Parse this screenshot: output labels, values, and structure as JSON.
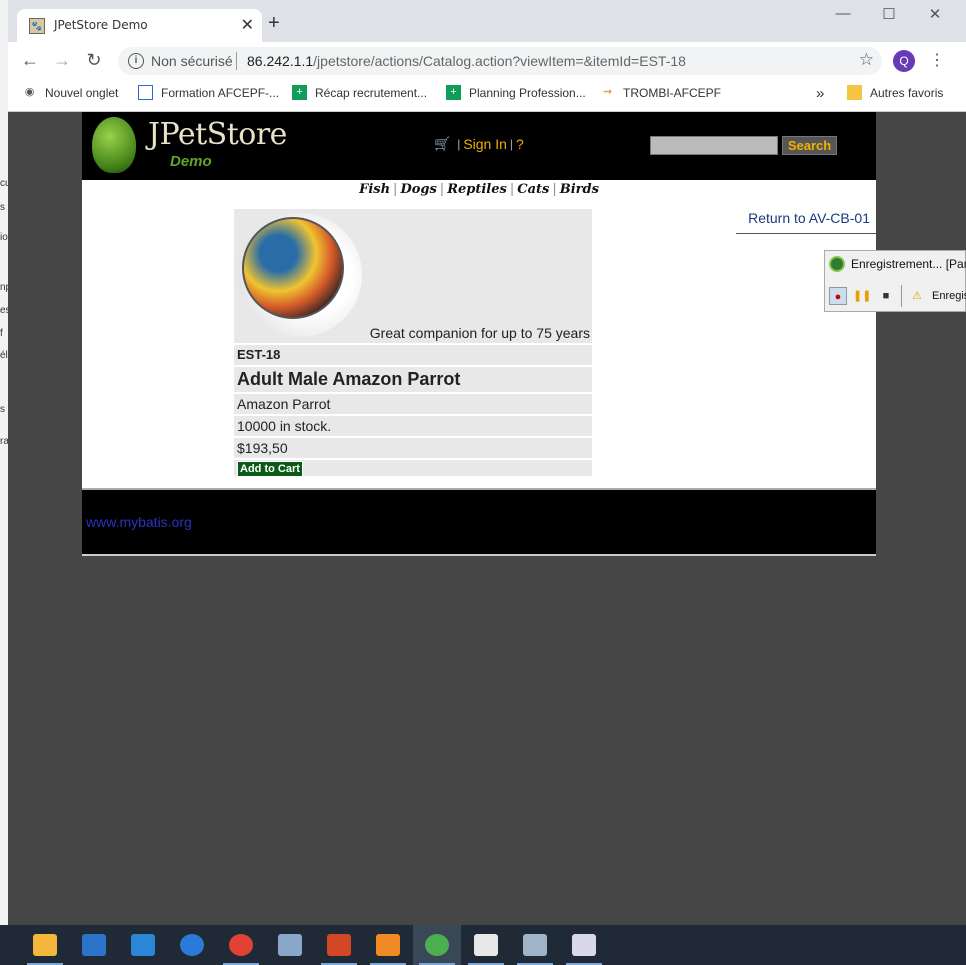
{
  "background_window_fragments": [
    "cu",
    "s",
    "io",
    "np",
    "es",
    "f",
    "él",
    "s l",
    "ra"
  ],
  "browser": {
    "tab_title": "JPetStore Demo",
    "tab_close": "✕",
    "new_tab": "+",
    "window_controls": {
      "minimize": "—",
      "maximize": "☐",
      "close": "✕"
    },
    "security_label": "Non sécurisé",
    "url_host": "86.242.1.1",
    "url_path": "/jpetstore/actions/Catalog.action?viewItem=&itemId=EST-18",
    "profile_initial": "Q",
    "bookmarks": [
      {
        "label": "Nouvel onglet",
        "icon": "globe-icon"
      },
      {
        "label": "Formation AFCEPF-...",
        "icon": "doc-icon"
      },
      {
        "label": "Récap recrutement...",
        "icon": "sheet-icon"
      },
      {
        "label": "Planning Profession...",
        "icon": "sheet-icon"
      },
      {
        "label": "TROMBI-AFCEPF",
        "icon": "link-icon"
      }
    ],
    "bookmarks_overflow": "»",
    "other_bookmarks": "Autres favoris"
  },
  "store": {
    "brand": "JPetStore",
    "brand_sub": "Demo",
    "sign_in": "Sign In",
    "help": "?",
    "search_button": "Search",
    "search_value": "",
    "categories": [
      "Fish",
      "Dogs",
      "Reptiles",
      "Cats",
      "Birds"
    ],
    "return_link": "Return to AV-CB-01",
    "item": {
      "description": "Great companion for up to 75 years",
      "id": "EST-18",
      "name": "Adult Male Amazon Parrot",
      "product": "Amazon Parrot",
      "stock": "10000 in stock.",
      "price": "$193,50",
      "add_to_cart": "Add to Cart"
    },
    "footer_link": "www.mybatis.org"
  },
  "recorder": {
    "title": "Enregistrement... [Parc",
    "status": "Enregistr"
  },
  "taskbar": [
    {
      "name": "file-explorer",
      "color": "#f2b73b"
    },
    {
      "name": "store",
      "color": "#2c74c9"
    },
    {
      "name": "mail",
      "color": "#2c86d8"
    },
    {
      "name": "edge",
      "color": "#2b7ad9"
    },
    {
      "name": "chrome",
      "color": "#e34133"
    },
    {
      "name": "app-blocks",
      "color": "#8aa6c8"
    },
    {
      "name": "powerpoint",
      "color": "#d24726"
    },
    {
      "name": "app-orange",
      "color": "#f08a24"
    },
    {
      "name": "recorder-app",
      "color": "#4caf50"
    },
    {
      "name": "java",
      "color": "#e8e8e8"
    },
    {
      "name": "monitor-app",
      "color": "#9fb4c8"
    },
    {
      "name": "screen-app",
      "color": "#d8d8e8"
    }
  ]
}
